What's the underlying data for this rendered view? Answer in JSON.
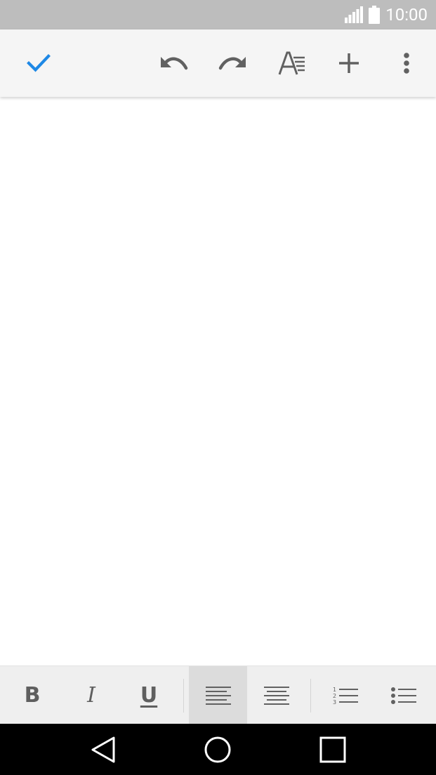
{
  "status_bar": {
    "time": "10:00",
    "icons": [
      "signal-icon",
      "battery-icon"
    ]
  },
  "toolbar": {
    "buttons": [
      {
        "name": "done",
        "icon": "checkmark-icon",
        "color": "#1e88e5"
      },
      {
        "name": "undo",
        "icon": "undo-icon"
      },
      {
        "name": "redo",
        "icon": "redo-icon"
      },
      {
        "name": "text-format",
        "icon": "text-format-icon"
      },
      {
        "name": "insert",
        "icon": "plus-icon"
      },
      {
        "name": "more-options",
        "icon": "more-vert-icon"
      }
    ]
  },
  "document": {
    "content": ""
  },
  "format_bar": {
    "bold_label": "B",
    "italic_label": "I",
    "underline_label": "U",
    "alignment_selected": "align-left",
    "icons": [
      "align-left-icon",
      "align-center-icon",
      "numbered-list-icon",
      "bulleted-list-icon"
    ]
  },
  "nav_bar": {
    "icons": [
      "back-icon",
      "home-icon",
      "recents-icon"
    ]
  },
  "colors": {
    "accent": "#1e88e5",
    "status_bar": "#bdbdbd",
    "toolbar": "#f5f5f5",
    "format_bar": "#efefef",
    "nav_bar": "#000000",
    "icon_gray": "#616161"
  }
}
